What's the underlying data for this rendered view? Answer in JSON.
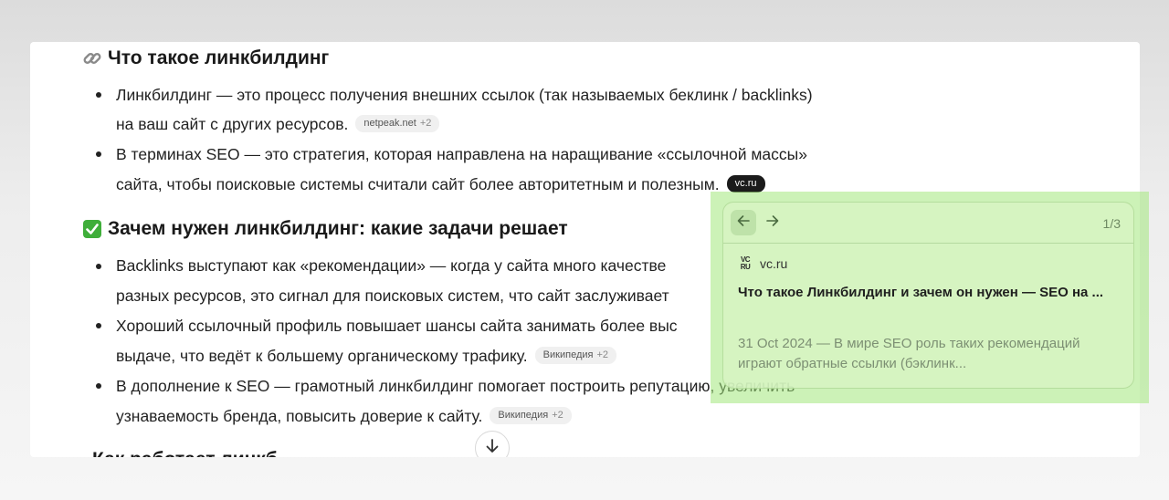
{
  "sections": {
    "what": {
      "title": "Что такое линкбилдинг"
    },
    "why": {
      "title": "Зачем нужен линкбилдинг: какие задачи решает"
    },
    "next": {
      "title_partial": "Как работает линкб"
    }
  },
  "bullets": {
    "b1": {
      "line1": "Линкбилдинг — это процесс получения внешних ссылок (так называемых беклинк / backlinks)",
      "line2": "на ваш сайт с других ресурсов.",
      "chip": "netpeak.net",
      "chip_plus": "+2"
    },
    "b2": {
      "line1": "В терминах SEO — это стратегия, которая направлена на наращивание «ссылочной массы»",
      "line2": "сайта, чтобы поисковые системы считали сайт более авторитетным и полезным.",
      "chip": "vc.ru"
    },
    "b3": {
      "line1": "Backlinks выступают как «рекомендации» — когда у сайта много качестве",
      "line2": "разных ресурсов, это сигнал для поисковых систем, что сайт заслуживает"
    },
    "b4": {
      "line1": "Хороший ссылочный профиль повышает шансы сайта занимать более выс",
      "line2": "выдаче, что ведёт к большему органическому трафику.",
      "chip": "Википедия",
      "chip_plus": "+2"
    },
    "b5": {
      "line1": "В дополнение к SEO — грамотный линкбилдинг помогает построить репутацию, увеличить",
      "line2": "узнаваемость бренда, повысить доверие к сайту.",
      "chip": "Википедия",
      "chip_plus": "+2"
    }
  },
  "popup": {
    "counter": "1/3",
    "source_name": "vc.ru",
    "source_icon_text": "VC RU",
    "title": "Что такое Линкбилдинг и зачем он нужен — SEO на ...",
    "snippet": "31 Oct 2024 — В мире SEO роль таких рекомендаций играют обратные ссылки (бэклинк..."
  },
  "colors": {
    "highlight": "#a3e87b",
    "accent_dark": "#1b1b1b"
  },
  "icons": {
    "section1": "link-icon",
    "section2": "check-box-icon",
    "scroll": "arrow-down-icon",
    "back": "arrow-left-icon",
    "forward": "arrow-right-icon"
  }
}
